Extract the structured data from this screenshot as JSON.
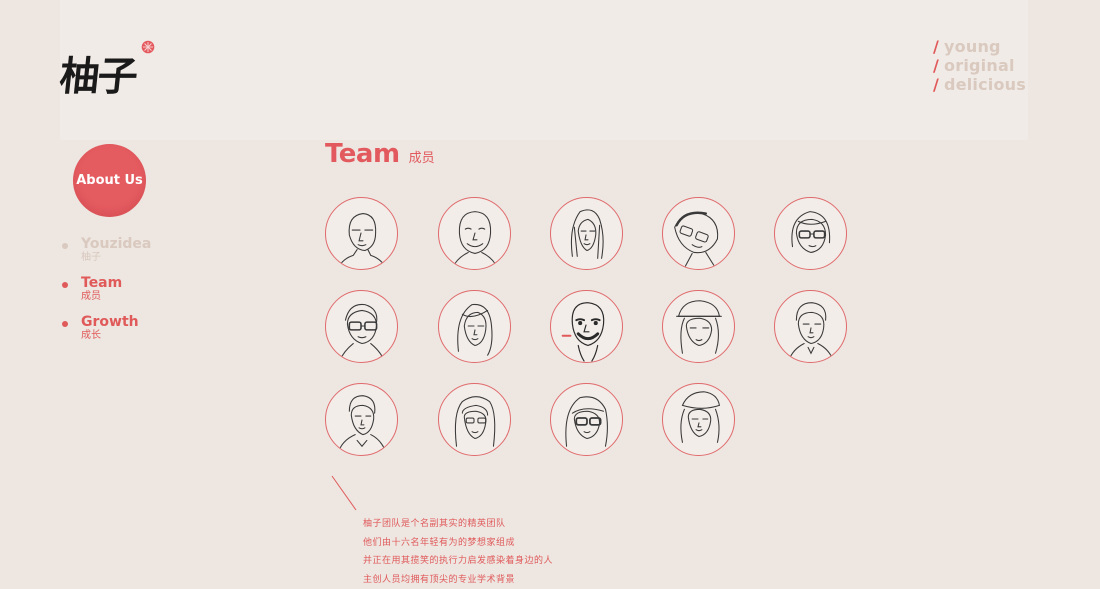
{
  "brand": {
    "logo_text": "柚子",
    "logo_mark_icon": "grapefruit-slice-icon",
    "tagline": [
      "young",
      "original",
      "delicious"
    ],
    "tagline_slash": "/",
    "accent_color": "#e45b60"
  },
  "about_button": {
    "label": "About Us"
  },
  "side_nav": {
    "items": [
      {
        "title": "Youzidea",
        "subtitle": "柚子",
        "state": "inactive"
      },
      {
        "title": "Team",
        "subtitle": "成员",
        "state": "active"
      },
      {
        "title": "Growth",
        "subtitle": "成长",
        "state": "active"
      }
    ]
  },
  "section": {
    "title_en": "Team",
    "title_cn": "成员"
  },
  "team": {
    "members": [
      {
        "icon": "bald-man-portrait-icon"
      },
      {
        "icon": "bald-smiling-man-portrait-icon"
      },
      {
        "icon": "long-hair-woman-portrait-icon"
      },
      {
        "icon": "tilted-head-glasses-man-portrait-icon"
      },
      {
        "icon": "glasses-woman-portrait-icon"
      },
      {
        "icon": "glasses-man-portrait-icon"
      },
      {
        "icon": "long-hair-woman-portrait-icon"
      },
      {
        "icon": "cigar-man-portrait-icon"
      },
      {
        "icon": "cap-woman-portrait-icon"
      },
      {
        "icon": "short-hair-man-portrait-icon"
      },
      {
        "icon": "young-man-portrait-icon"
      },
      {
        "icon": "bangs-woman-portrait-icon"
      },
      {
        "icon": "glasses-bangs-woman-portrait-icon"
      },
      {
        "icon": "cap-girl-portrait-icon"
      }
    ]
  },
  "intro": {
    "lines": [
      "柚子团队是个名副其实的精英团队",
      "他们由十六名年轻有为的梦想家组成",
      "并正在用其揽笑的执行力启发感染着身边的人",
      "主创人员均拥有顶尖的专业学术背景"
    ]
  }
}
